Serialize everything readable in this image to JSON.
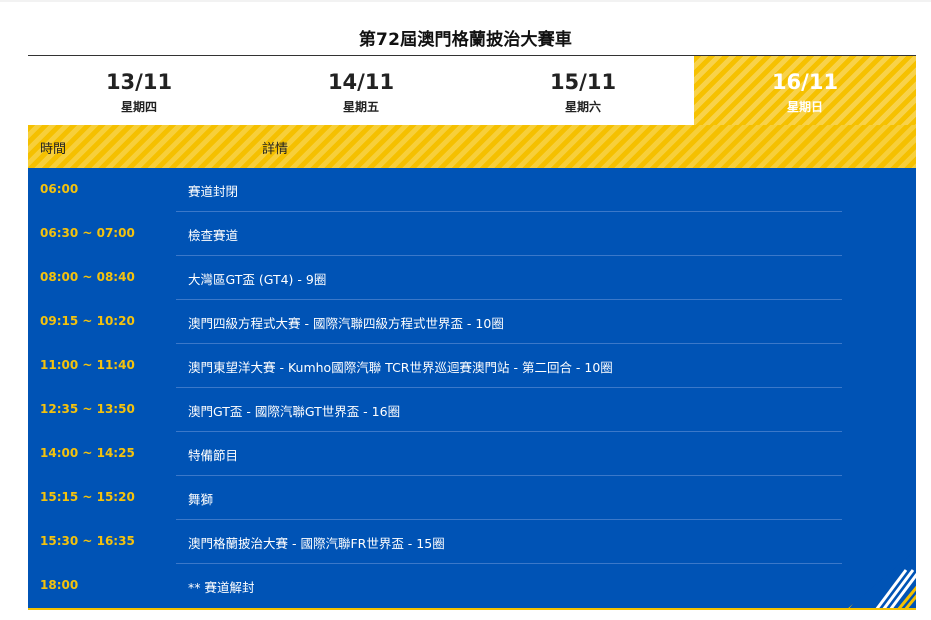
{
  "page": {
    "title": "第72屆澳門格蘭披治大賽車"
  },
  "tabs": [
    {
      "date": "13/11",
      "weekday": "星期四",
      "active": false
    },
    {
      "date": "14/11",
      "weekday": "星期五",
      "active": false
    },
    {
      "date": "15/11",
      "weekday": "星期六",
      "active": false
    },
    {
      "date": "16/11",
      "weekday": "星期日",
      "active": true
    }
  ],
  "table": {
    "headers": {
      "time": "時間",
      "details": "詳情"
    },
    "rows": [
      {
        "time": "06:00",
        "details": "賽道封閉"
      },
      {
        "time": "06:30 ~ 07:00",
        "details": "檢查賽道"
      },
      {
        "time": "08:00 ~ 08:40",
        "details": "大灣區GT盃 (GT4) - 9圈"
      },
      {
        "time": "09:15 ~ 10:20",
        "details": "澳門四級方程式大賽 - 國際汽聯四級方程式世界盃 - 10圈"
      },
      {
        "time": "11:00 ~ 11:40",
        "details": "澳門東望洋大賽 - Kumho國際汽聯 TCR世界巡迴賽澳門站 - 第二回合 - 10圈"
      },
      {
        "time": "12:35 ~ 13:50",
        "details": "澳門GT盃 - 國際汽聯GT世界盃 - 16圈"
      },
      {
        "time": "14:00 ~ 14:25",
        "details": "特備節目"
      },
      {
        "time": "15:15 ~ 15:20",
        "details": "舞獅"
      },
      {
        "time": "15:30 ~ 16:35",
        "details": "澳門格蘭披治大賽 - 國際汽聯FR世界盃 - 15圈"
      },
      {
        "time": "18:00",
        "details": "** 賽道解封"
      }
    ]
  },
  "colors": {
    "accent": "#f5c000",
    "panel": "#0053b5",
    "time_text": "#f4c20d"
  }
}
